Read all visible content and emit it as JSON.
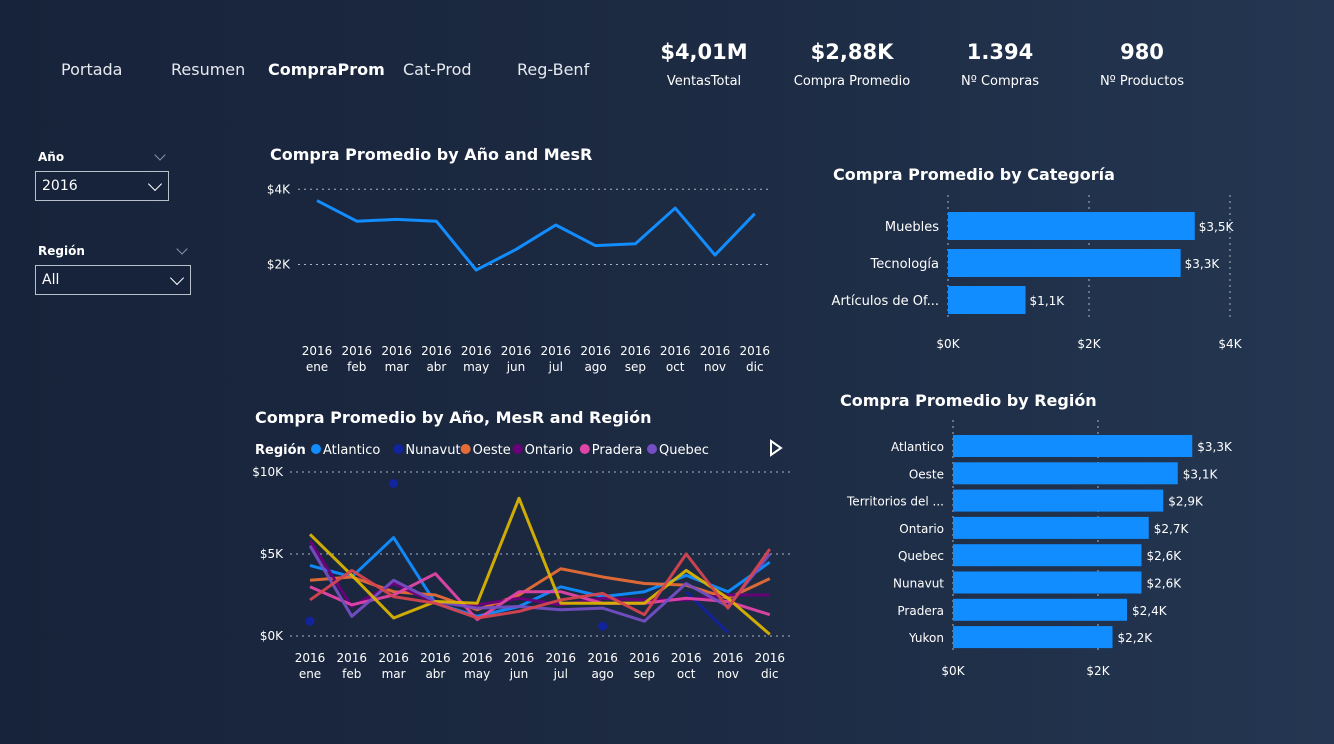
{
  "nav": {
    "items": [
      {
        "label": "Portada"
      },
      {
        "label": "Resumen"
      },
      {
        "label": "CompraProm"
      },
      {
        "label": "Cat-Prod"
      },
      {
        "label": "Reg-Benf"
      }
    ],
    "active": "CompraProm"
  },
  "kpis": [
    {
      "value": "$4,01M",
      "label": "VentasTotal"
    },
    {
      "value": "$2,88K",
      "label": "Compra Promedio"
    },
    {
      "value": "1.394",
      "label": "Nº Compras"
    },
    {
      "value": "980",
      "label": "Nº Productos"
    }
  ],
  "slicers": {
    "year": {
      "label": "Año",
      "value": "2016"
    },
    "region": {
      "label": "Región",
      "value": "All"
    }
  },
  "colors": {
    "accent": "#118DFF",
    "Atlantico": "#118DFF",
    "Nunavut": "#12239E",
    "Oeste": "#E66C37",
    "Ontario": "#6B007B",
    "Pradera": "#E044A7",
    "Quebec": "#744EC2",
    "Territorios": "#D9B300",
    "Yukon": "#D64550"
  },
  "chart_data": [
    {
      "id": "line_month",
      "type": "line",
      "title": "Compra Promedio by Año and MesR",
      "categories": [
        "2016 ene",
        "2016 feb",
        "2016 mar",
        "2016 abr",
        "2016 may",
        "2016 jun",
        "2016 jul",
        "2016 ago",
        "2016 sep",
        "2016 oct",
        "2016 nov",
        "2016 dic"
      ],
      "cat_top": [
        "2016",
        "2016",
        "2016",
        "2016",
        "2016",
        "2016",
        "2016",
        "2016",
        "2016",
        "2016",
        "2016",
        "2016"
      ],
      "cat_bottom": [
        "ene",
        "feb",
        "mar",
        "abr",
        "may",
        "jun",
        "jul",
        "ago",
        "sep",
        "oct",
        "nov",
        "dic"
      ],
      "values": [
        3700,
        3150,
        3200,
        3150,
        1850,
        2400,
        3050,
        2500,
        2550,
        3500,
        2250,
        3350
      ],
      "yticks": [
        {
          "value": 2000,
          "label": "$2K"
        },
        {
          "value": 4000,
          "label": "$4K"
        }
      ],
      "ylim": [
        1400,
        4300
      ],
      "grid": true
    },
    {
      "id": "bar_category",
      "type": "bar",
      "title": "Compra Promedio by Categoría",
      "categories": [
        "Muebles",
        "Tecnología",
        "Artículos de Of..."
      ],
      "values": [
        3500,
        3300,
        1100
      ],
      "data_labels": [
        "$3,5K",
        "$3,3K",
        "$1,1K"
      ],
      "xticks": [
        {
          "value": 0,
          "label": "$0K"
        },
        {
          "value": 2000,
          "label": "$2K"
        },
        {
          "value": 4000,
          "label": "$4K"
        }
      ],
      "xlim": [
        0,
        4000
      ],
      "grid": true
    },
    {
      "id": "line_region",
      "type": "line",
      "title": "Compra Promedio by Año, MesR and Región",
      "legend_title": "Región",
      "legend_position": "top",
      "cat_top": [
        "2016",
        "2016",
        "2016",
        "2016",
        "2016",
        "2016",
        "2016",
        "2016",
        "2016",
        "2016",
        "2016",
        "2016"
      ],
      "cat_bottom": [
        "ene",
        "feb",
        "mar",
        "abr",
        "may",
        "jun",
        "jul",
        "ago",
        "sep",
        "oct",
        "nov",
        "dic"
      ],
      "yticks": [
        {
          "value": 0,
          "label": "$0K"
        },
        {
          "value": 5000,
          "label": "$5K"
        },
        {
          "value": 10000,
          "label": "$10K"
        }
      ],
      "ylim": [
        0,
        10000
      ],
      "series": [
        {
          "name": "Atlantico",
          "legend": true,
          "values": [
            4300,
            3600,
            6000,
            2000,
            1200,
            1800,
            3000,
            2400,
            2700,
            3700,
            2700,
            4500
          ]
        },
        {
          "name": "Nunavut",
          "legend": true,
          "values": [
            900,
            null,
            9300,
            null,
            null,
            null,
            null,
            600,
            null,
            2700,
            200,
            null
          ]
        },
        {
          "name": "Oeste",
          "legend": true,
          "values": [
            3400,
            3600,
            2700,
            2500,
            1600,
            2500,
            4100,
            3600,
            3200,
            3100,
            2300,
            3500
          ]
        },
        {
          "name": "Ontario",
          "legend": true,
          "values": [
            5800,
            1800,
            3200,
            2000,
            1900,
            2300,
            1900,
            2300,
            2200,
            2200,
            2500,
            2500
          ]
        },
        {
          "name": "Pradera",
          "legend": true,
          "values": [
            3000,
            1900,
            2500,
            3800,
            1000,
            2700,
            2700,
            2000,
            2000,
            2300,
            2100,
            1300
          ]
        },
        {
          "name": "Quebec",
          "legend": true,
          "values": [
            5500,
            1200,
            3400,
            2100,
            1700,
            1800,
            1600,
            1700,
            900,
            3200,
            1800,
            5000
          ]
        },
        {
          "name": "Territorios",
          "legend": false,
          "values": [
            6200,
            3700,
            1100,
            2100,
            2000,
            8400,
            2000,
            2000,
            2000,
            4000,
            2300,
            100
          ]
        },
        {
          "name": "Yukon",
          "legend": false,
          "values": [
            2200,
            4000,
            2400,
            2000,
            1100,
            1500,
            2200,
            2600,
            1300,
            5000,
            1700,
            5300
          ]
        }
      ],
      "grid": true
    },
    {
      "id": "bar_region",
      "type": "bar",
      "title": "Compra Promedio by Región",
      "categories": [
        "Atlantico",
        "Oeste",
        "Territorios del ...",
        "Ontario",
        "Quebec",
        "Nunavut",
        "Pradera",
        "Yukon"
      ],
      "values": [
        3300,
        3100,
        2900,
        2700,
        2600,
        2600,
        2400,
        2200
      ],
      "data_labels": [
        "$3,3K",
        "$3,1K",
        "$2,9K",
        "$2,7K",
        "$2,6K",
        "$2,6K",
        "$2,4K",
        "$2,2K"
      ],
      "xticks": [
        {
          "value": 0,
          "label": "$0K"
        },
        {
          "value": 2000,
          "label": "$2K"
        }
      ],
      "xlim": [
        0,
        4000
      ],
      "grid": true
    }
  ]
}
